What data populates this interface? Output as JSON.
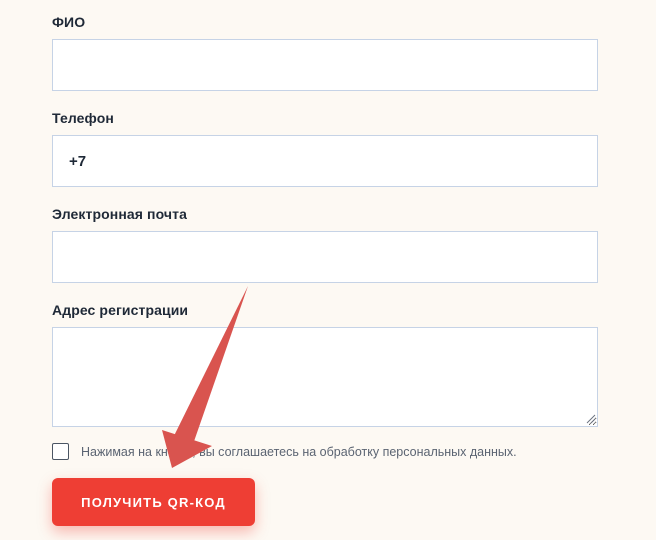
{
  "form": {
    "fields": [
      {
        "label": "ФИО",
        "value": ""
      },
      {
        "label": "Телефон",
        "value": "+7"
      },
      {
        "label": "Электронная почта",
        "value": ""
      },
      {
        "label": "Адрес регистрации",
        "value": ""
      }
    ],
    "consent": {
      "text": "Нажимая на кнопку, вы соглашаетесь на обработку персональных данных.",
      "checked": false
    },
    "submit_label": "ПОЛУЧИТЬ QR-КОД"
  },
  "annotation": {
    "arrow_icon": "arrow-pointing-to-submit-icon",
    "arrow_color": "#d9544f"
  },
  "colors": {
    "accent": "#ee3e34",
    "input_border": "#c6d3e6",
    "background": "#fdf9f3"
  }
}
